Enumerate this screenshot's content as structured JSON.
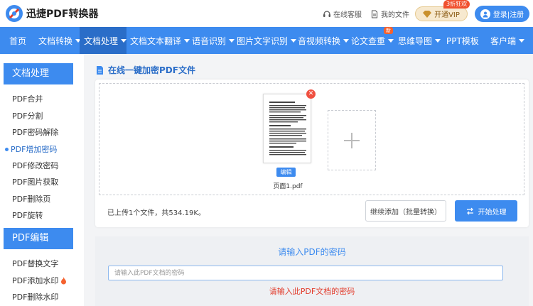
{
  "header": {
    "brand": "迅捷PDF转换器",
    "support": "在线客服",
    "my_files": "我的文件",
    "vip_label": "开通VIP",
    "vip_badge": "3折狂欢",
    "login": "登录|注册"
  },
  "nav": {
    "items": [
      {
        "label": "首页",
        "caret": false
      },
      {
        "label": "文档转换",
        "caret": true
      },
      {
        "label": "文档处理",
        "caret": true,
        "active": true
      },
      {
        "label": "文档文本翻译",
        "caret": true
      },
      {
        "label": "语音识别",
        "caret": true
      },
      {
        "label": "图片文字识别",
        "caret": true
      },
      {
        "label": "音视频转换",
        "caret": true
      },
      {
        "label": "论文查重",
        "caret": true,
        "badge": "新"
      },
      {
        "label": "思维导图",
        "caret": true
      },
      {
        "label": "PPT模板",
        "caret": false
      },
      {
        "label": "客户端",
        "caret": true
      }
    ]
  },
  "sidebar": {
    "section1_title": "文档处理",
    "section1_items": [
      "PDF合并",
      "PDF分割",
      "PDF密码解除",
      "PDF增加密码",
      "PDF修改密码",
      "PDF图片获取",
      "PDF删除页",
      "PDF旋转"
    ],
    "section2_title": "PDF编辑",
    "section2_items": [
      "PDF替换文字",
      "PDF添加水印",
      "PDF删除水印"
    ]
  },
  "main": {
    "title": "在线一键加密PDF文件",
    "file_name": "页面1.pdf",
    "edit_label": "编辑",
    "remove_symbol": "✕",
    "status": "已上传1个文件，共534.19K。",
    "continue_label": "继续添加（批量转换）",
    "start_label": "开始处理"
  },
  "password": {
    "title": "请输入PDF的密码",
    "placeholder": "请输入此PDF文档的密码",
    "error": "请输入此PDF文档的密码"
  },
  "colors": {
    "primary": "#3d8bef",
    "nav_active": "#2a6dc8",
    "error": "#e23b2b"
  }
}
